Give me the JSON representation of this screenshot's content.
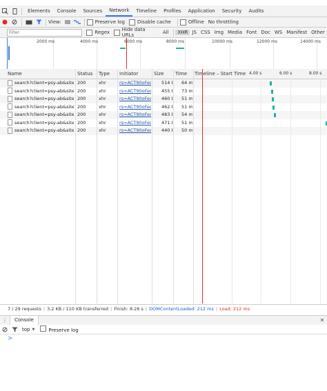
{
  "tabs": [
    "Elements",
    "Console",
    "Sources",
    "Network",
    "Timeline",
    "Profiles",
    "Application",
    "Security",
    "Audits"
  ],
  "active_tab": "Network",
  "toolbar": {
    "view_label": "View:",
    "preserve_log": "Preserve log",
    "disable_cache": "Disable cache",
    "offline": "Offline",
    "throttling": "No throttling"
  },
  "filterbar": {
    "placeholder": "Filter",
    "regex": "Regex",
    "hide_data_urls": "Hide data URLs",
    "types": [
      "All",
      "XHR",
      "JS",
      "CSS",
      "Img",
      "Media",
      "Font",
      "Doc",
      "WS",
      "Manifest",
      "Other"
    ],
    "active_type": "XHR"
  },
  "overview": {
    "ticks": [
      "2000 ms",
      "4000 ms",
      "6000 ms",
      "8000 ms",
      "10000 ms",
      "12000 ms",
      "14000 ms"
    ]
  },
  "table": {
    "headers": {
      "name": "Name",
      "status": "Status",
      "type": "Type",
      "initiator": "Initiator",
      "size": "Size",
      "time": "Time",
      "timeline": "Timeline – Start Time"
    },
    "timeline_ticks": [
      "4.00 s",
      "6.00 s",
      "8.00 s"
    ],
    "rows": [
      {
        "name": "search?client=psy-ab&site=...",
        "status": "200",
        "type": "xhr",
        "initiator": "rs=ACT90oFeq...",
        "size": "514 B",
        "time": "64 ms",
        "start": 0.57
      },
      {
        "name": "search?client=psy-ab&site=...",
        "status": "200",
        "type": "xhr",
        "initiator": "rs=ACT90oFeq...",
        "size": "455 B",
        "time": "73 ms",
        "start": 0.58
      },
      {
        "name": "search?client=psy-ab&site=...",
        "status": "200",
        "type": "xhr",
        "initiator": "rs=ACT90oFeq...",
        "size": "460 B",
        "time": "51 ms",
        "start": 0.585
      },
      {
        "name": "search?client=psy-ab&site=...",
        "status": "200",
        "type": "xhr",
        "initiator": "rs=ACT90oFeq...",
        "size": "462 B",
        "time": "51 ms",
        "start": 0.59
      },
      {
        "name": "search?client=psy-ab&site=...",
        "status": "200",
        "type": "xhr",
        "initiator": "rs=ACT90oFeq...",
        "size": "483 B",
        "time": "54 ms",
        "start": 0.6
      },
      {
        "name": "search?client=psy-ab&site=...",
        "status": "200",
        "type": "xhr",
        "initiator": "rs=ACT90oFeq...",
        "size": "471 B",
        "time": "51 ms",
        "start": 0.99
      },
      {
        "name": "search?client=psy-ab&site=...",
        "status": "200",
        "type": "xhr",
        "initiator": "rs=ACT90oFeq...",
        "size": "440 B",
        "time": "50 ms",
        "start": null
      }
    ]
  },
  "statusbar": {
    "requests": "7 / 29 requests",
    "transferred": "3.2 KB / 110 KB transferred",
    "finish": "Finish: 8.26 s",
    "dcl": "DOMContentLoaded: 212 ms",
    "load": "Load: 212 ms"
  },
  "drawer": {
    "tab": "Console",
    "context": "top",
    "preserve_log": "Preserve log",
    "prompt": ">"
  },
  "colors": {
    "accent": "#3b78e7",
    "record": "#d93025",
    "waterfall": "#20b2a0",
    "dcl_line": "#1a5bd6",
    "load_line": "#d93025"
  }
}
